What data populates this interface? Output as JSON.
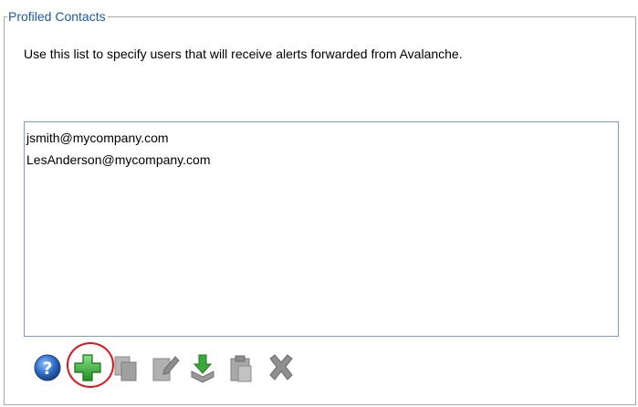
{
  "group": {
    "title": "Profiled Contacts",
    "description": "Use this list to specify users that will receive alerts forwarded from Avalanche."
  },
  "contacts": [
    "jsmith@mycompany.com",
    "LesAnderson@mycompany.com"
  ],
  "toolbar": {
    "icons": [
      "help-icon",
      "add-icon",
      "copy-icon",
      "edit-icon",
      "import-icon",
      "paste-icon",
      "delete-icon"
    ],
    "highlighted": "add-icon"
  },
  "colors": {
    "title": "#1e5aa8",
    "highlight_ring": "#e0141e",
    "add_green": "#2fa82f",
    "help_blue": "#2e6cc8",
    "disabled_gray": "#9a9a9a"
  }
}
